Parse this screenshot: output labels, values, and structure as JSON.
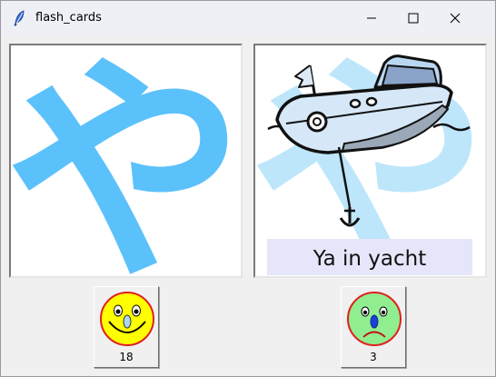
{
  "window": {
    "title": "flash_cards"
  },
  "cards": {
    "left": {
      "glyph": "や"
    },
    "right": {
      "glyph": "や",
      "caption": "Ya in yacht"
    }
  },
  "score": {
    "correct_count": "18",
    "wrong_count": "3"
  },
  "icons": {
    "app": "feather-icon",
    "minimize": "minimize-icon",
    "maximize": "maximize-icon",
    "close": "close-icon",
    "happy": "happy-face-icon",
    "sad": "sad-face-icon"
  },
  "colors": {
    "glyph_blue": "#5bc1fb",
    "glyph_light_blue": "#bde6fb",
    "caption_bg": "#e6e6fa",
    "happy_face": "#ffff00",
    "sad_face": "#90ee90",
    "face_outline": "#e02020"
  }
}
